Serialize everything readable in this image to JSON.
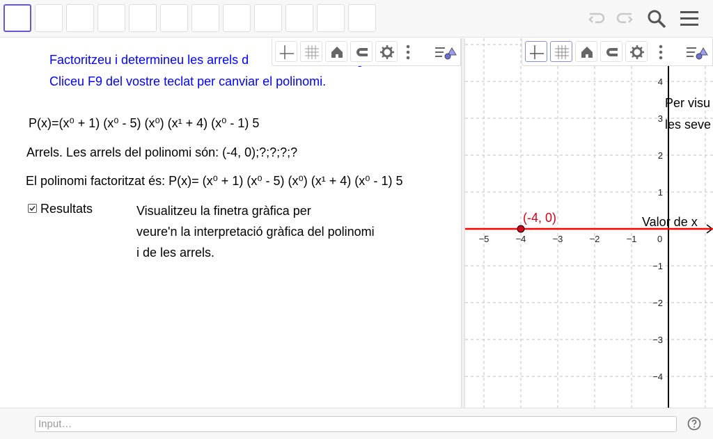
{
  "toolbar": {
    "tool_count": 12,
    "undo_icon": "undo-icon",
    "redo_icon": "redo-icon",
    "search_icon": "search-icon",
    "menu_icon": "menu-icon"
  },
  "style_bar_icons": [
    "axes-icon",
    "grid-icon",
    "home-icon",
    "magnet-icon",
    "gear-icon",
    "more-icon",
    "view-toggle-icon"
  ],
  "algebra": {
    "instruction_line1": "Factoritzeu i determineu les arrels d",
    "instruction_line1_tail": "g",
    "instruction_line2": "Cliceu F9 del vostre teclat per canviar el polinomi.",
    "polynomial": "P(x)=(x⁰ + 1) (x⁰ - 5) (x⁰) (x¹ + 4) (x⁰ - 1) 5",
    "roots_text": "Arrels. Les arrels del polinomi són: (-4, 0);?;?;?;?",
    "factored_text": "El polinomi factoritzat és:  P(x)= (x⁰ + 1) (x⁰ - 5) (x⁰) (x¹ + 4) (x⁰ - 1) 5",
    "checkbox_label": "Resultats",
    "checkbox_checked": true,
    "note_line1": "Visualitzeu la finetra gràfica per",
    "note_line2": "veure'n la interpretació gràfica del polinomi",
    "note_line3": "i de les arrels."
  },
  "graphics": {
    "x_ticks": [
      "−5",
      "−4",
      "−3",
      "−2",
      "−1",
      "0"
    ],
    "y_ticks_pos": [
      "4",
      "3",
      "2",
      "1"
    ],
    "y_ticks_neg": [
      "−1",
      "−2",
      "−3",
      "−4"
    ],
    "point_label": "(-4, 0)",
    "point_x": -4,
    "point_y": 0,
    "axis_label_x": "Valor de x",
    "overlay_line1": "Per visu",
    "overlay_line2": "les seve",
    "line_color": "#ff0000",
    "point_color": "#d0021b"
  },
  "input_bar": {
    "placeholder": "Input…",
    "help_icon": "help-icon"
  }
}
